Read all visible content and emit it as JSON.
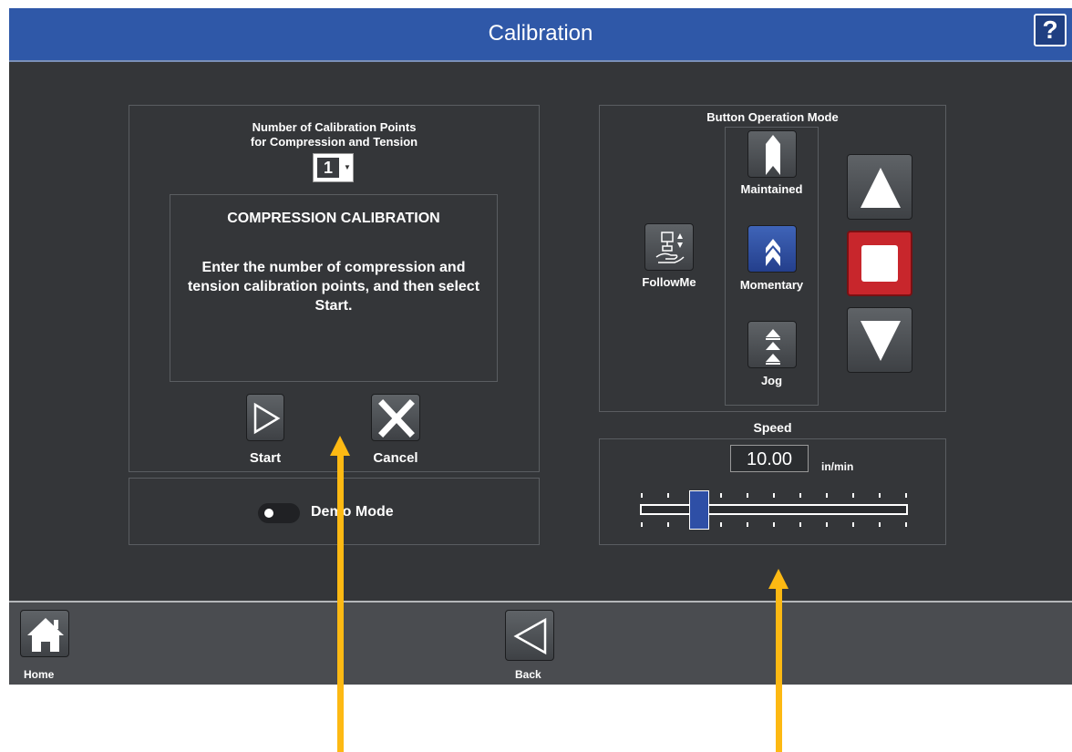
{
  "header": {
    "title": "Calibration",
    "help_label": "?"
  },
  "calibration_panel": {
    "points_label_line1": "Number of Calibration Points",
    "points_label_line2": "for Compression and Tension",
    "points_value": "1",
    "message_title": "COMPRESSION CALIBRATION",
    "message_body": "Enter the number of compression and tension calibration points, and then select Start.",
    "start_label": "Start",
    "cancel_label": "Cancel"
  },
  "demo": {
    "label": "Demo Mode",
    "enabled": false
  },
  "operation_mode": {
    "title": "Button Operation Mode",
    "followme_label": "FollowMe",
    "maintained_label": "Maintained",
    "momentary_label": "Momentary",
    "jog_label": "Jog",
    "selected": "Momentary"
  },
  "jog_controls": {
    "up_icon": "up-triangle-icon",
    "stop_icon": "stop-square-icon",
    "down_icon": "down-triangle-icon",
    "stop_color": "#c8262c"
  },
  "speed": {
    "title": "Speed",
    "value": "10.00",
    "unit": "in/min",
    "slider_fraction": 0.22
  },
  "bottom_nav": {
    "home_label": "Home",
    "back_label": "Back"
  },
  "colors": {
    "header": "#2f58a8",
    "background": "#343639",
    "accent_blue": "#2e4fa6",
    "annotation_arrow": "#fdb913"
  }
}
